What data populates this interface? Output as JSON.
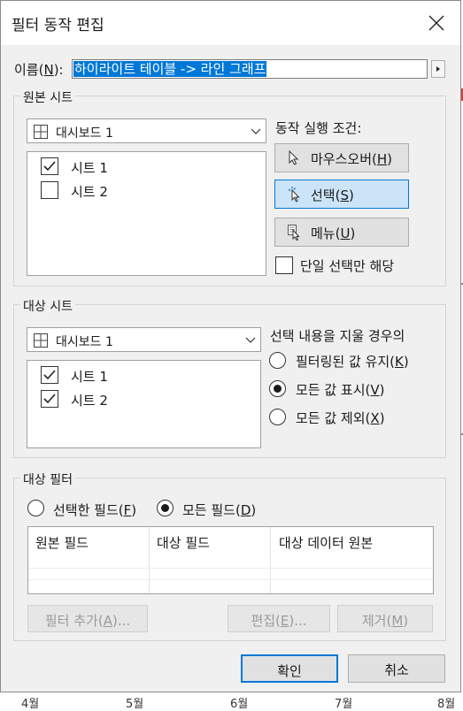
{
  "dialog": {
    "title": "필터 동작 편집",
    "name_label": "이름(N):",
    "name_value": "하이라이트 테이블 -> 라인 그래프"
  },
  "source": {
    "legend": "원본 시트",
    "dashboard": "대시보드 1",
    "sheets": [
      {
        "label": "시트 1",
        "checked": true
      },
      {
        "label": "시트 2",
        "checked": false
      }
    ],
    "run_label": "동작 실행 조건:",
    "run_options": [
      {
        "label": "마우스오버",
        "key": "H",
        "icon": "cursor-icon",
        "selected": false
      },
      {
        "label": "선택",
        "key": "S",
        "icon": "click-cursor-icon",
        "selected": true
      },
      {
        "label": "메뉴",
        "key": "U",
        "icon": "menu-cursor-icon",
        "selected": false
      }
    ],
    "single_select_label": "단일 선택만 해당",
    "single_select_checked": false
  },
  "target": {
    "legend": "대상 시트",
    "dashboard": "대시보드 1",
    "sheets": [
      {
        "label": "시트 1",
        "checked": true
      },
      {
        "label": "시트 2",
        "checked": true
      }
    ],
    "clear_label": "선택 내용을 지울 경우의",
    "clear_options": [
      {
        "label": "필터링된 값 유지",
        "key": "K",
        "selected": false
      },
      {
        "label": "모든 값 표시",
        "key": "V",
        "selected": true
      },
      {
        "label": "모든 값 제외",
        "key": "X",
        "selected": false
      }
    ]
  },
  "filters": {
    "legend": "대상 필터",
    "options": [
      {
        "label": "선택한 필드",
        "key": "F",
        "selected": false
      },
      {
        "label": "모든 필드",
        "key": "D",
        "selected": true
      }
    ],
    "columns": [
      "원본 필드",
      "대상 필드",
      "대상 데이터 원본"
    ],
    "add_label": "필터 추가",
    "add_key": "A",
    "edit_label": "편집",
    "edit_key": "E",
    "remove_label": "제거",
    "remove_key": "M"
  },
  "footer": {
    "ok_label": "확인",
    "cancel_label": "취소"
  },
  "background": {
    "axis_ticks": [
      "4월",
      "5월",
      "6월",
      "7월",
      "8월"
    ]
  },
  "colors": {
    "accent": "#0078d7",
    "selected_button": "#cce4f7",
    "dialog_bg": "#f0f0f0"
  }
}
